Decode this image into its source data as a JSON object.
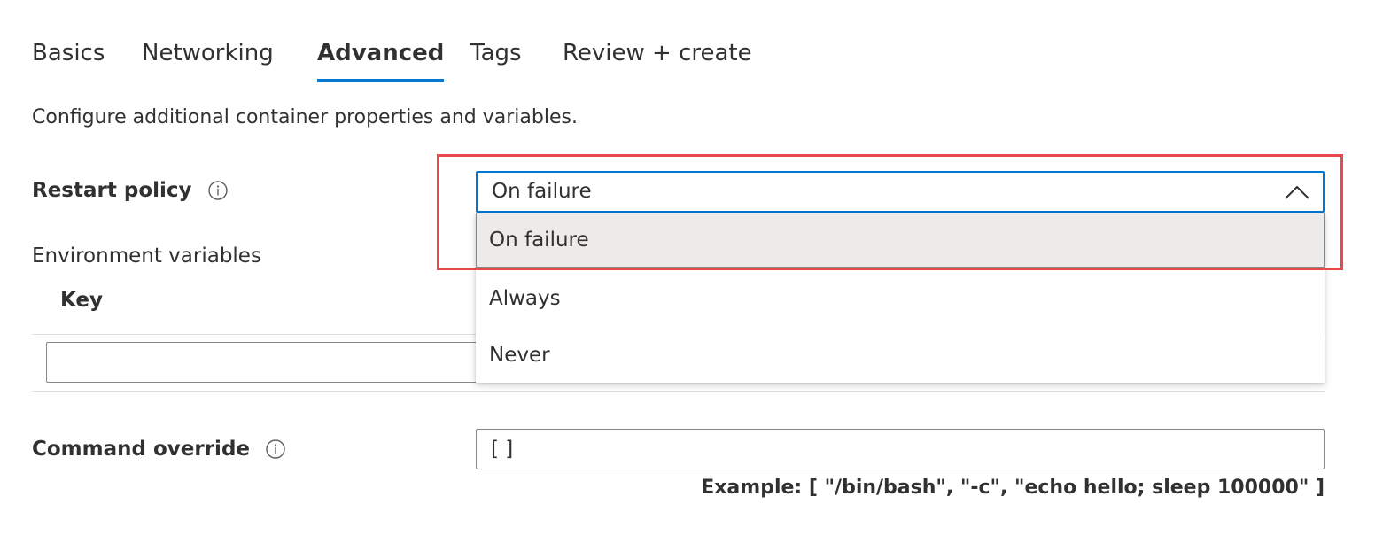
{
  "tabs": [
    {
      "label": "Basics"
    },
    {
      "label": "Networking"
    },
    {
      "label": "Advanced"
    },
    {
      "label": "Tags"
    },
    {
      "label": "Review + create"
    }
  ],
  "active_tab": "Advanced",
  "description": "Configure additional container properties and variables.",
  "restart_policy": {
    "label": "Restart policy",
    "info_icon": "info-icon",
    "selected_value": "On failure",
    "dropdown_icon": "chevron-up-icon",
    "options": [
      "On failure",
      "Always",
      "Never"
    ]
  },
  "environment_variables": {
    "label": "Environment variables",
    "key_header": "Key",
    "key_value": "",
    "value_value": ""
  },
  "command_override": {
    "label": "Command override",
    "info_icon": "info-icon",
    "value": "[ ]",
    "example": "Example: [ \"/bin/bash\", \"-c\", \"echo hello; sleep 100000\" ]"
  },
  "colors": {
    "accent": "#0078d4",
    "highlight": "#e8474b",
    "selected_option_bg": "#edebe9",
    "text": "#323130"
  }
}
